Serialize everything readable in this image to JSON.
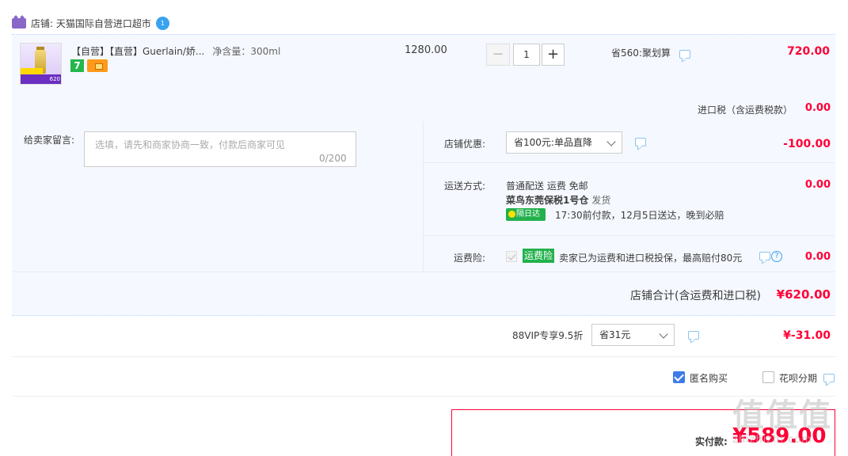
{
  "shop": {
    "name": "店铺: 天猫国际自营进口超市",
    "ww_badge": "1"
  },
  "item": {
    "thumb_price": "620",
    "title": "【自营】【直营】Guerlain/娇...",
    "spec": "净含量：300ml",
    "unit_price": "1280.00",
    "quantity": "1",
    "qty_minus": "−",
    "qty_plus": "+",
    "promo": "省560:聚划算",
    "total": "720.00"
  },
  "tax": {
    "label": "进口税（含运费税款）",
    "value": "0.00"
  },
  "message": {
    "label": "给卖家留言:",
    "placeholder": "选填，请先和商家协商一致，付款后商家可见",
    "count": "0/200"
  },
  "shop_discount": {
    "label": "店铺优惠:",
    "selected": "省100元:单品直降",
    "value": "-100.00"
  },
  "shipping": {
    "label": "运送方式:",
    "method": "普通配送 运费 免邮",
    "warehouse": "菜鸟东莞保税1号仓",
    "dispatch": "发货",
    "next_day_tag": "隔日达",
    "eta": "17:30前付款，12月5日送达，晚到必赔",
    "value": "0.00"
  },
  "insurance": {
    "label": "运费险:",
    "tag": "运费险",
    "text": "卖家已为运费和进口税投保，最高赔付80元",
    "help": "?",
    "value": "0.00"
  },
  "shop_total": {
    "label": "店铺合计(含运费和进口税)",
    "value": "¥620.00"
  },
  "vip": {
    "label": "88VIP专享9.5折",
    "selected": "省31元",
    "value": "¥-31.00"
  },
  "options": {
    "anonymous": "匿名购买",
    "huabei": "花呗分期"
  },
  "payment": {
    "label": "实付款:",
    "value": "¥589.00"
  },
  "watermark": {
    "big": "值值值",
    "small": "zhizhizhi.com"
  },
  "colors": {
    "accent_red": "#ff0036",
    "panel_bg": "#f5f8ff",
    "brand_blue": "#3d7ce8",
    "green_tag": "#23b14d"
  }
}
